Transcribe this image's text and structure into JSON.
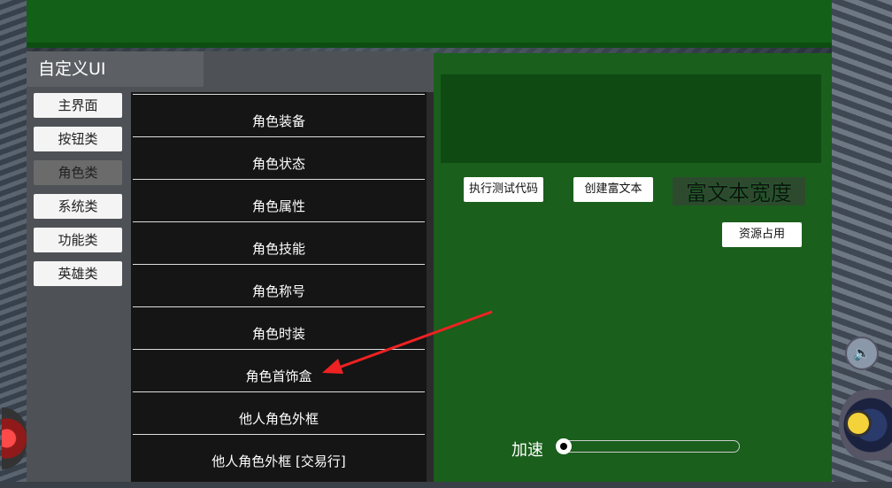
{
  "window": {
    "title": "自定义UI"
  },
  "categories": [
    {
      "label": "主界面",
      "active": false
    },
    {
      "label": "按钮类",
      "active": false
    },
    {
      "label": "角色类",
      "active": true
    },
    {
      "label": "系统类",
      "active": false
    },
    {
      "label": "功能类",
      "active": false
    },
    {
      "label": "英雄类",
      "active": false
    }
  ],
  "items": [
    {
      "label": "角色装备"
    },
    {
      "label": "角色状态"
    },
    {
      "label": "角色属性"
    },
    {
      "label": "角色技能"
    },
    {
      "label": "角色称号"
    },
    {
      "label": "角色时装"
    },
    {
      "label": "角色首饰盒"
    },
    {
      "label": "他人角色外框"
    },
    {
      "label": "他人角色外框 [交易行]"
    }
  ],
  "right": {
    "run_test_code": "执行测试代码",
    "create_rich_text": "创建富文本",
    "rich_text_width": "富文本宽度",
    "resource_usage": "资源占用",
    "speed_label": "加速",
    "speed_value": 0
  },
  "colors": {
    "panel_green": "#1a5f1c",
    "annotation_arrow": "#ee2222"
  }
}
